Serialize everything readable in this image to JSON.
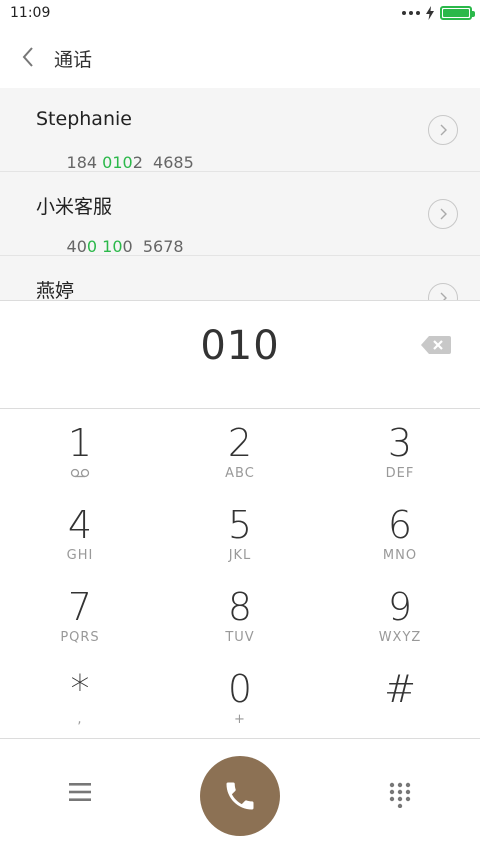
{
  "status_bar": {
    "time": "11:09",
    "battery_color": "#2bb84a"
  },
  "header": {
    "title": "通话"
  },
  "results": [
    {
      "name": "Stephanie",
      "number_parts": [
        {
          "t": "184 ",
          "m": false
        },
        {
          "t": "010",
          "m": true
        },
        {
          "t": "2  4685",
          "m": false
        }
      ]
    },
    {
      "name": "小米客服",
      "number_parts": [
        {
          "t": "40",
          "m": false
        },
        {
          "t": "0 10",
          "m": true
        },
        {
          "t": "0  5678",
          "m": false
        }
      ]
    },
    {
      "name": "燕婷",
      "number_parts": []
    }
  ],
  "entered_number": "010",
  "keypad": [
    {
      "digit": "1",
      "letters": "",
      "icon": "voicemail-icon"
    },
    {
      "digit": "2",
      "letters": "ABC"
    },
    {
      "digit": "3",
      "letters": "DEF"
    },
    {
      "digit": "4",
      "letters": "GHI"
    },
    {
      "digit": "5",
      "letters": "JKL"
    },
    {
      "digit": "6",
      "letters": "MNO"
    },
    {
      "digit": "7",
      "letters": "PQRS"
    },
    {
      "digit": "8",
      "letters": "TUV"
    },
    {
      "digit": "9",
      "letters": "WXYZ"
    },
    {
      "digit": "*",
      "letters": ","
    },
    {
      "digit": "0",
      "letters": "+"
    },
    {
      "digit": "#",
      "letters": ""
    }
  ],
  "colors": {
    "accent_match": "#2bb84a",
    "call_button": "#8c7154"
  }
}
